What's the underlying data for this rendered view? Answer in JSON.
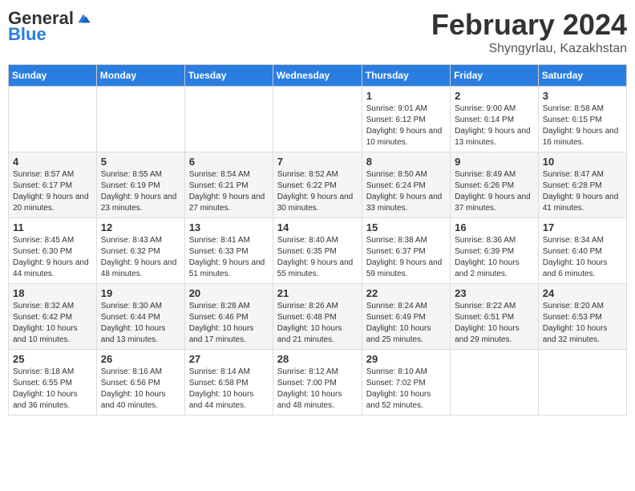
{
  "logo": {
    "general": "General",
    "blue": "Blue"
  },
  "title": "February 2024",
  "subtitle": "Shyngyrlau, Kazakhstan",
  "weekdays": [
    "Sunday",
    "Monday",
    "Tuesday",
    "Wednesday",
    "Thursday",
    "Friday",
    "Saturday"
  ],
  "weeks": [
    [
      {
        "day": "",
        "sunrise": "",
        "sunset": "",
        "daylight": ""
      },
      {
        "day": "",
        "sunrise": "",
        "sunset": "",
        "daylight": ""
      },
      {
        "day": "",
        "sunrise": "",
        "sunset": "",
        "daylight": ""
      },
      {
        "day": "",
        "sunrise": "",
        "sunset": "",
        "daylight": ""
      },
      {
        "day": "1",
        "sunrise": "Sunrise: 9:01 AM",
        "sunset": "Sunset: 6:12 PM",
        "daylight": "Daylight: 9 hours and 10 minutes."
      },
      {
        "day": "2",
        "sunrise": "Sunrise: 9:00 AM",
        "sunset": "Sunset: 6:14 PM",
        "daylight": "Daylight: 9 hours and 13 minutes."
      },
      {
        "day": "3",
        "sunrise": "Sunrise: 8:58 AM",
        "sunset": "Sunset: 6:15 PM",
        "daylight": "Daylight: 9 hours and 16 minutes."
      }
    ],
    [
      {
        "day": "4",
        "sunrise": "Sunrise: 8:57 AM",
        "sunset": "Sunset: 6:17 PM",
        "daylight": "Daylight: 9 hours and 20 minutes."
      },
      {
        "day": "5",
        "sunrise": "Sunrise: 8:55 AM",
        "sunset": "Sunset: 6:19 PM",
        "daylight": "Daylight: 9 hours and 23 minutes."
      },
      {
        "day": "6",
        "sunrise": "Sunrise: 8:54 AM",
        "sunset": "Sunset: 6:21 PM",
        "daylight": "Daylight: 9 hours and 27 minutes."
      },
      {
        "day": "7",
        "sunrise": "Sunrise: 8:52 AM",
        "sunset": "Sunset: 6:22 PM",
        "daylight": "Daylight: 9 hours and 30 minutes."
      },
      {
        "day": "8",
        "sunrise": "Sunrise: 8:50 AM",
        "sunset": "Sunset: 6:24 PM",
        "daylight": "Daylight: 9 hours and 33 minutes."
      },
      {
        "day": "9",
        "sunrise": "Sunrise: 8:49 AM",
        "sunset": "Sunset: 6:26 PM",
        "daylight": "Daylight: 9 hours and 37 minutes."
      },
      {
        "day": "10",
        "sunrise": "Sunrise: 8:47 AM",
        "sunset": "Sunset: 6:28 PM",
        "daylight": "Daylight: 9 hours and 41 minutes."
      }
    ],
    [
      {
        "day": "11",
        "sunrise": "Sunrise: 8:45 AM",
        "sunset": "Sunset: 6:30 PM",
        "daylight": "Daylight: 9 hours and 44 minutes."
      },
      {
        "day": "12",
        "sunrise": "Sunrise: 8:43 AM",
        "sunset": "Sunset: 6:32 PM",
        "daylight": "Daylight: 9 hours and 48 minutes."
      },
      {
        "day": "13",
        "sunrise": "Sunrise: 8:41 AM",
        "sunset": "Sunset: 6:33 PM",
        "daylight": "Daylight: 9 hours and 51 minutes."
      },
      {
        "day": "14",
        "sunrise": "Sunrise: 8:40 AM",
        "sunset": "Sunset: 6:35 PM",
        "daylight": "Daylight: 9 hours and 55 minutes."
      },
      {
        "day": "15",
        "sunrise": "Sunrise: 8:38 AM",
        "sunset": "Sunset: 6:37 PM",
        "daylight": "Daylight: 9 hours and 59 minutes."
      },
      {
        "day": "16",
        "sunrise": "Sunrise: 8:36 AM",
        "sunset": "Sunset: 6:39 PM",
        "daylight": "Daylight: 10 hours and 2 minutes."
      },
      {
        "day": "17",
        "sunrise": "Sunrise: 8:34 AM",
        "sunset": "Sunset: 6:40 PM",
        "daylight": "Daylight: 10 hours and 6 minutes."
      }
    ],
    [
      {
        "day": "18",
        "sunrise": "Sunrise: 8:32 AM",
        "sunset": "Sunset: 6:42 PM",
        "daylight": "Daylight: 10 hours and 10 minutes."
      },
      {
        "day": "19",
        "sunrise": "Sunrise: 8:30 AM",
        "sunset": "Sunset: 6:44 PM",
        "daylight": "Daylight: 10 hours and 13 minutes."
      },
      {
        "day": "20",
        "sunrise": "Sunrise: 8:28 AM",
        "sunset": "Sunset: 6:46 PM",
        "daylight": "Daylight: 10 hours and 17 minutes."
      },
      {
        "day": "21",
        "sunrise": "Sunrise: 8:26 AM",
        "sunset": "Sunset: 6:48 PM",
        "daylight": "Daylight: 10 hours and 21 minutes."
      },
      {
        "day": "22",
        "sunrise": "Sunrise: 8:24 AM",
        "sunset": "Sunset: 6:49 PM",
        "daylight": "Daylight: 10 hours and 25 minutes."
      },
      {
        "day": "23",
        "sunrise": "Sunrise: 8:22 AM",
        "sunset": "Sunset: 6:51 PM",
        "daylight": "Daylight: 10 hours and 29 minutes."
      },
      {
        "day": "24",
        "sunrise": "Sunrise: 8:20 AM",
        "sunset": "Sunset: 6:53 PM",
        "daylight": "Daylight: 10 hours and 32 minutes."
      }
    ],
    [
      {
        "day": "25",
        "sunrise": "Sunrise: 8:18 AM",
        "sunset": "Sunset: 6:55 PM",
        "daylight": "Daylight: 10 hours and 36 minutes."
      },
      {
        "day": "26",
        "sunrise": "Sunrise: 8:16 AM",
        "sunset": "Sunset: 6:56 PM",
        "daylight": "Daylight: 10 hours and 40 minutes."
      },
      {
        "day": "27",
        "sunrise": "Sunrise: 8:14 AM",
        "sunset": "Sunset: 6:58 PM",
        "daylight": "Daylight: 10 hours and 44 minutes."
      },
      {
        "day": "28",
        "sunrise": "Sunrise: 8:12 AM",
        "sunset": "Sunset: 7:00 PM",
        "daylight": "Daylight: 10 hours and 48 minutes."
      },
      {
        "day": "29",
        "sunrise": "Sunrise: 8:10 AM",
        "sunset": "Sunset: 7:02 PM",
        "daylight": "Daylight: 10 hours and 52 minutes."
      },
      {
        "day": "",
        "sunrise": "",
        "sunset": "",
        "daylight": ""
      },
      {
        "day": "",
        "sunrise": "",
        "sunset": "",
        "daylight": ""
      }
    ]
  ]
}
